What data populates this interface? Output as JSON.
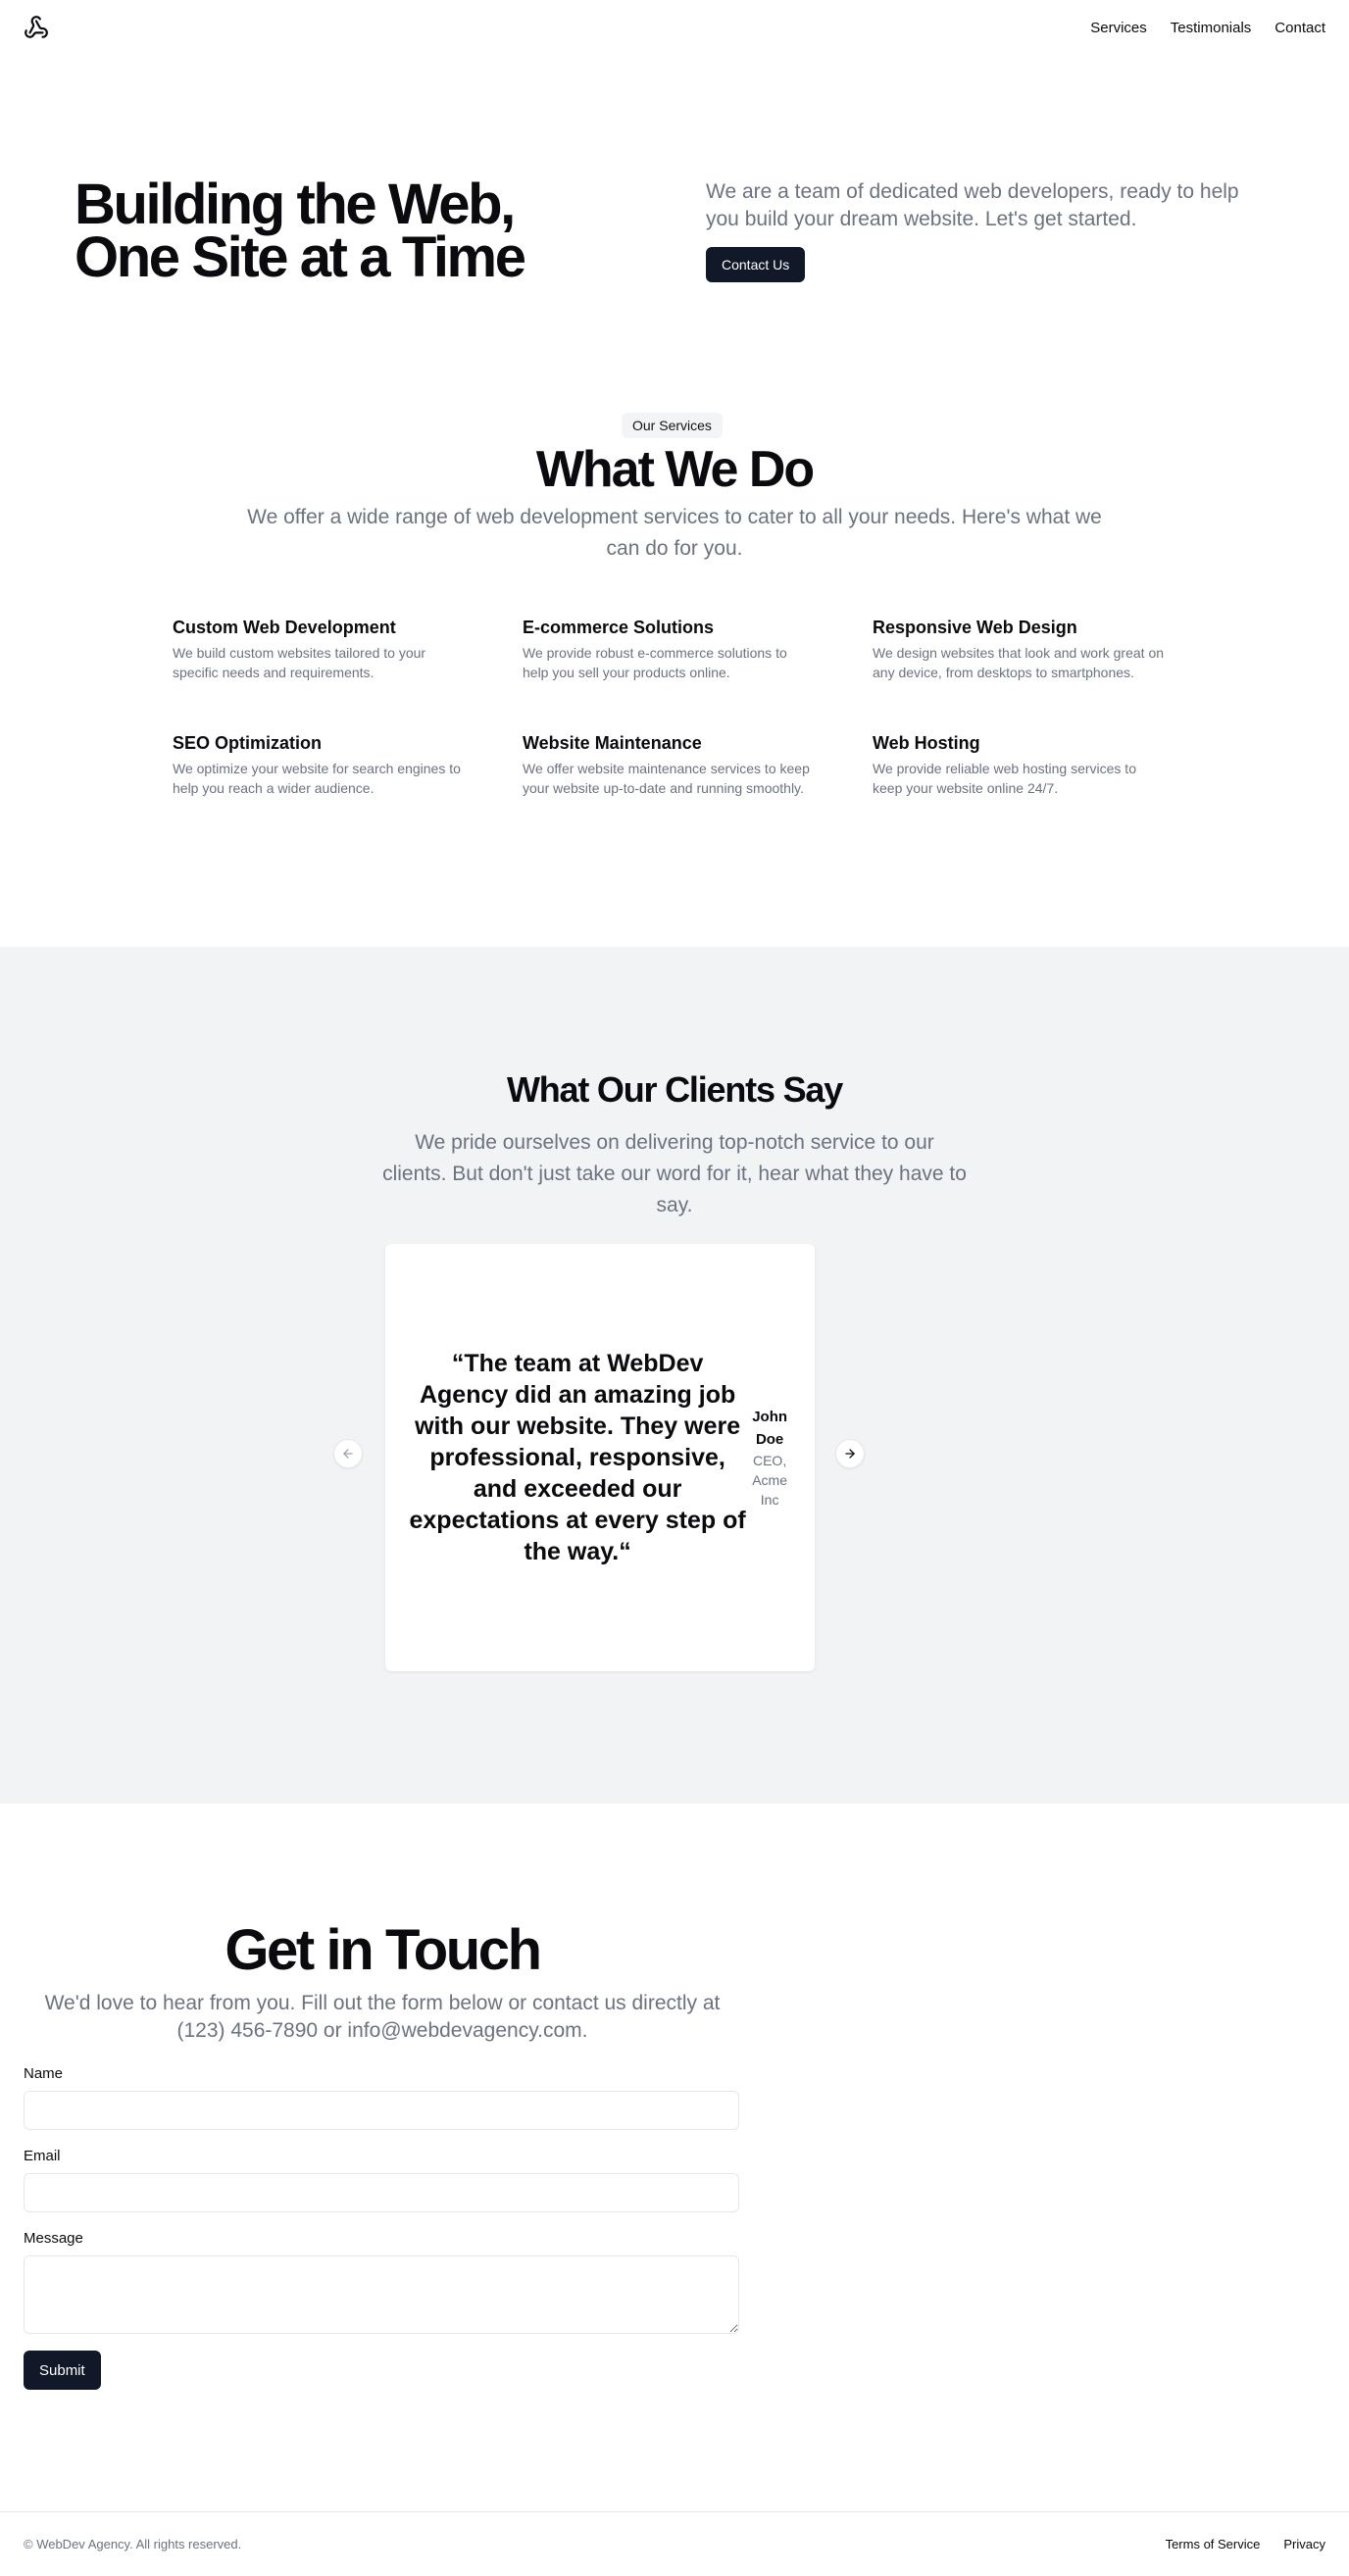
{
  "header": {
    "logo_icon": "webhook-icon",
    "nav": [
      "Services",
      "Testimonials",
      "Contact"
    ]
  },
  "hero": {
    "title": "Building the Web, One Site at a Time",
    "subtitle": "We are a team of dedicated web developers, ready to help you build your dream website. Let's get started.",
    "cta_label": "Contact Us"
  },
  "services": {
    "badge": "Our Services",
    "title": "What We Do",
    "subtitle": "We offer a wide range of web development services to cater to all your needs. Here's what we can do for you.",
    "items": [
      {
        "title": "Custom Web Development",
        "desc": "We build custom websites tailored to your specific needs and requirements."
      },
      {
        "title": "E-commerce Solutions",
        "desc": "We provide robust e-commerce solutions to help you sell your products online."
      },
      {
        "title": "Responsive Web Design",
        "desc": "We design websites that look and work great on any device, from desktops to smartphones."
      },
      {
        "title": "SEO Optimization",
        "desc": "We optimize your website for search engines to help you reach a wider audience."
      },
      {
        "title": "Website Maintenance",
        "desc": "We offer website maintenance services to keep your website up-to-date and running smoothly."
      },
      {
        "title": "Web Hosting",
        "desc": "We provide reliable web hosting services to keep your website online 24/7."
      }
    ]
  },
  "testimonials": {
    "title": "What Our Clients Say",
    "subtitle": "We pride ourselves on delivering top-notch service to our clients. But don't just take our word for it, hear what they have to say.",
    "quote": "“The team at WebDev Agency did an amazing job with our website. They were professional, responsive, and exceeded our expectations at every step of the way.“",
    "author_name": "John Doe",
    "author_role": "CEO, Acme Inc",
    "prev_icon": "arrow-left-icon",
    "next_icon": "arrow-right-icon"
  },
  "contact": {
    "title": "Get in Touch",
    "subtitle": "We'd love to hear from you. Fill out the form below or contact us directly at (123) 456-7890 or info@webdevagency.com.",
    "name_label": "Name",
    "name_value": "",
    "email_label": "Email",
    "email_value": "",
    "message_label": "Message",
    "message_value": "",
    "submit_label": "Submit"
  },
  "footer": {
    "copyright": "© WebDev Agency. All rights reserved.",
    "links": [
      "Terms of Service",
      "Privacy"
    ]
  },
  "colors": {
    "primary_dark": "#111827",
    "muted_text": "#6b7280",
    "section_bg": "#f2f3f5"
  }
}
